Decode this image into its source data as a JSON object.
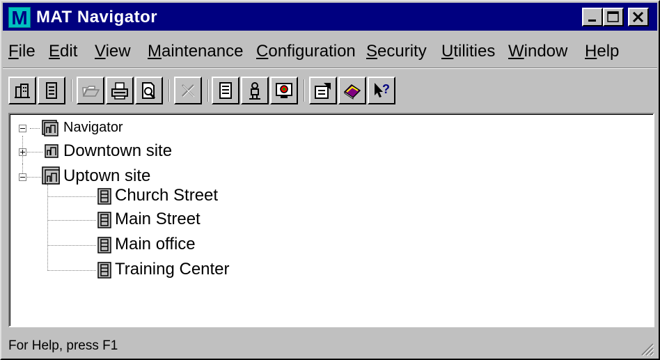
{
  "window": {
    "title": "MAT Navigator",
    "app_icon_letter": "M",
    "controls": [
      "minimize-icon",
      "maximize-icon",
      "close-icon"
    ]
  },
  "menu": {
    "items": [
      {
        "label": "File",
        "u": "F",
        "rest": "ile"
      },
      {
        "label": "Edit",
        "u": "E",
        "rest": "dit"
      },
      {
        "label": "View",
        "u": "V",
        "rest": "iew"
      },
      {
        "label": "Maintenance",
        "u": "M",
        "rest": "aintenance"
      },
      {
        "label": "Configuration",
        "u": "C",
        "rest": "onfiguration"
      },
      {
        "label": "Security",
        "u": "S",
        "rest": "ecurity"
      },
      {
        "label": "Utilities",
        "u": "U",
        "rest": "tilities"
      },
      {
        "label": "Window",
        "u": "W",
        "rest": "indow"
      },
      {
        "label": "Help",
        "u": "H",
        "rest": "elp"
      }
    ]
  },
  "toolbar": {
    "buttons": [
      {
        "name": "site-icon",
        "enabled": true
      },
      {
        "name": "building-icon",
        "enabled": true
      },
      {
        "name": "open-folder-icon",
        "enabled": false
      },
      {
        "name": "print-icon",
        "enabled": true
      },
      {
        "name": "print-preview-icon",
        "enabled": true
      },
      {
        "name": "delete-icon",
        "enabled": false
      },
      {
        "name": "report-icon",
        "enabled": true
      },
      {
        "name": "person-icon",
        "enabled": true
      },
      {
        "name": "monitor-icon",
        "enabled": true
      },
      {
        "name": "properties-icon",
        "enabled": true
      },
      {
        "name": "help-book-icon",
        "enabled": true
      },
      {
        "name": "context-help-icon",
        "enabled": true
      }
    ]
  },
  "tree": {
    "root": {
      "label": "Navigator",
      "expanded": true
    },
    "sites": [
      {
        "label": "Downtown site",
        "expanded": false
      },
      {
        "label": "Uptown site",
        "expanded": true
      }
    ],
    "buildings": [
      {
        "label": "Church Street"
      },
      {
        "label": "Main Street"
      },
      {
        "label": "Main office"
      },
      {
        "label": "Training Center"
      }
    ]
  },
  "status": {
    "text": "For Help, press F1"
  },
  "colors": {
    "titlebar": "#000080",
    "face": "#c0c0c0",
    "tree_background": "#ffffff"
  }
}
